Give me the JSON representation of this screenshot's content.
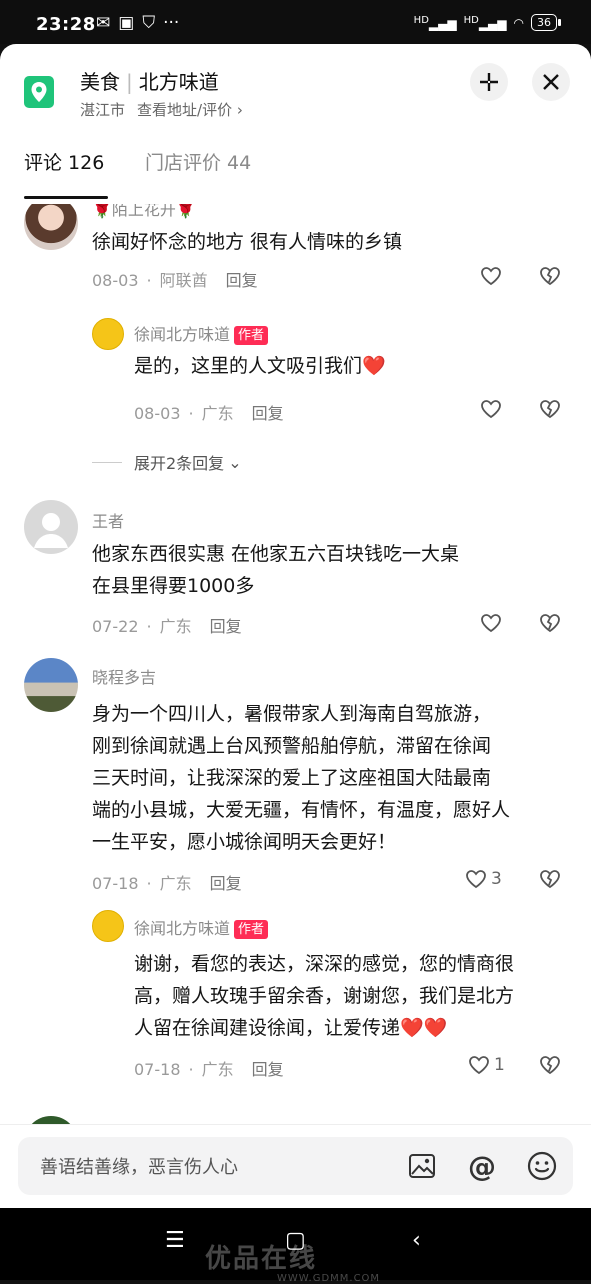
{
  "status": {
    "time": "23:28",
    "battery": "36",
    "net1": "HD",
    "net2": "HD"
  },
  "header": {
    "category": "美食",
    "shop": "北方味道",
    "city": "湛江市",
    "link": "查看地址/评价 ›"
  },
  "tabs": [
    {
      "label": "评论 126"
    },
    {
      "label": "门店评价 44"
    }
  ],
  "comments": [
    {
      "user": "🌹陌上花开🌹",
      "text_lines": [
        "徐闻好怀念的地方 很有人情味的乡镇"
      ],
      "date": "08-03",
      "location": "阿联酋",
      "reply_label": "回复",
      "likes": ""
    },
    {
      "user": "徐闻北方味道",
      "badge": "作者",
      "text_lines": [
        "是的，这里的人文吸引我们❤️"
      ],
      "date": "08-03",
      "location": "广东",
      "reply_label": "回复",
      "likes": ""
    },
    {
      "user": "王者",
      "text_lines": [
        "他家东西很实惠  在他家五六百块钱吃一大桌",
        "在县里得要1000多"
      ],
      "date": "07-22",
      "location": "广东",
      "reply_label": "回复",
      "likes": ""
    },
    {
      "user": "晓程多吉",
      "text_lines": [
        "身为一个四川人，暑假带家人到海南自驾旅游，",
        "刚到徐闻就遇上台风预警船舶停航，滞留在徐闻",
        "三天时间，让我深深的爱上了这座祖国大陆最南",
        "端的小县城，大爱无疆，有情怀，有温度，愿好人",
        "一生平安，愿小城徐闻明天会更好！"
      ],
      "date": "07-18",
      "location": "广东",
      "reply_label": "回复",
      "likes": "3"
    },
    {
      "user": "徐闻北方味道",
      "badge": "作者",
      "text_lines": [
        "谢谢，看您的表达，深深的感觉，您的情商很",
        "高，赠人玫瑰手留余香，谢谢您，我们是北方",
        "人留在徐闻建设徐闻，让爱传递❤️❤️"
      ],
      "date": "07-18",
      "location": "广东",
      "reply_label": "回复",
      "likes": "1"
    }
  ],
  "expand_label": "展开2条回复",
  "input": {
    "placeholder": "善语结善缘，恶言伤人心"
  },
  "colors": {
    "accent": "#fe2c55",
    "location_icon": "#1fc47a"
  },
  "watermark": {
    "main": "优品在线",
    "sub": "WWW.GDMM.COM"
  }
}
